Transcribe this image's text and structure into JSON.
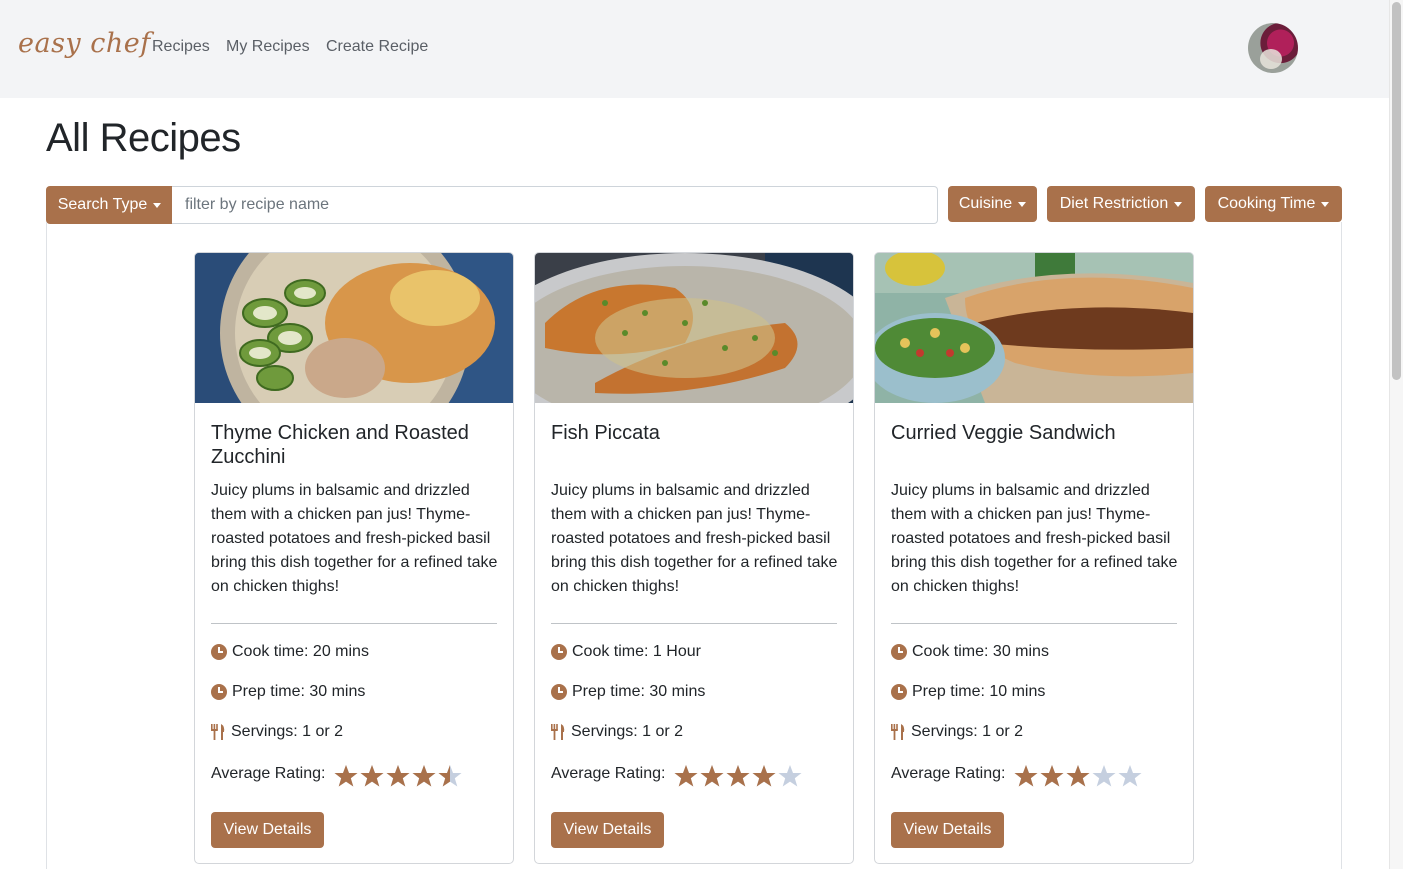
{
  "navbar": {
    "brand": "easy chef",
    "links": [
      "Recipes",
      "My Recipes",
      "Create Recipe"
    ]
  },
  "page": {
    "title": "All Recipes"
  },
  "search": {
    "type_label": "Search Type",
    "placeholder": "filter by recipe name",
    "value": ""
  },
  "filters": {
    "cuisine": "Cuisine",
    "diet": "Diet Restriction",
    "time": "Cooking Time"
  },
  "labels": {
    "rating": "Average Rating:",
    "view": "View Details"
  },
  "recipes": [
    {
      "title": "Thyme Chicken and Roasted Zucchini",
      "description": "Juicy plums in balsamic and drizzled them with a chicken pan jus! Thyme-roasted potatoes and fresh-picked basil bring this dish together for a refined take on chicken thighs!",
      "cook_time": "Cook time: 20 mins",
      "prep_time": "Prep time: 30 mins",
      "servings": "Servings: 1 or 2",
      "rating": 4.5
    },
    {
      "title": "Fish Piccata",
      "description": "Juicy plums in balsamic and drizzled them with a chicken pan jus! Thyme-roasted potatoes and fresh-picked basil bring this dish together for a refined take on chicken thighs!",
      "cook_time": "Cook time: 1 Hour",
      "prep_time": "Prep time: 30 mins",
      "servings": "Servings: 1 or 2",
      "rating": 4
    },
    {
      "title": "Curried Veggie Sandwich",
      "description": "Juicy plums in balsamic and drizzled them with a chicken pan jus! Thyme-roasted potatoes and fresh-picked basil bring this dish together for a refined take on chicken thighs!",
      "cook_time": "Cook time: 30 mins",
      "prep_time": "Prep time: 10 mins",
      "servings": "Servings: 1 or 2",
      "rating": 3
    }
  ],
  "colors": {
    "accent": "#a9714b",
    "star_empty": "#c5cfdf",
    "navbar_bg": "#f3f4f6"
  }
}
